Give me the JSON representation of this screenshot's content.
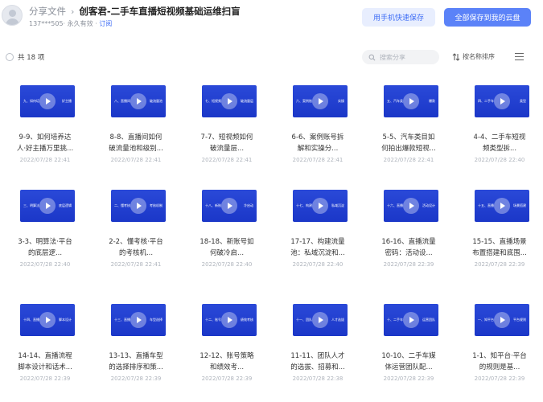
{
  "header": {
    "breadcrumb_root": "分享文件",
    "separator": "›",
    "title": "创客君-二手车直播短视频基础运维扫盲",
    "owner": "137***505",
    "validity": "· 永久有效 · ",
    "subscribe": "订阅",
    "save_phone_label": "用手机快速保存",
    "save_all_label": "全部保存到我的云盘"
  },
  "toolbar": {
    "total": "共 18 项",
    "search_placeholder": "搜索分享",
    "sort_label": "按名称排序"
  },
  "files": [
    {
      "line1": "9-9、如何培养达",
      "line2": "人·好主播万里挑...",
      "date": "2022/07/28 22:41",
      "cap_left": "九、如何培",
      "cap_right": "好主播"
    },
    {
      "line1": "8-8、直播间如何",
      "line2": "破流量池和级别...",
      "date": "2022/07/28 22:41",
      "cap_left": "八、直播间",
      "cap_right": "破流量池"
    },
    {
      "line1": "7-7、短视频如何",
      "line2": "破流量层...",
      "date": "2022/07/28 22:41",
      "cap_left": "七、短视频",
      "cap_right": "破流量层"
    },
    {
      "line1": "6-6、案例账号拆",
      "line2": "解和实操分...",
      "date": "2022/07/28 22:41",
      "cap_left": "六、案例账",
      "cap_right": "实操"
    },
    {
      "line1": "5-5、汽车类目如",
      "line2": "何拍出爆款短视...",
      "date": "2022/07/28 22:41",
      "cap_left": "五、汽车类",
      "cap_right": "爆款"
    },
    {
      "line1": "4-4、二手车短视",
      "line2": "频类型拆...",
      "date": "2022/07/28 22:40",
      "cap_left": "四、二手车",
      "cap_right": "类型"
    },
    {
      "line1": "3-3、明算法·平台",
      "line2": "的底层逻...",
      "date": "2022/07/28 22:40",
      "cap_left": "三、明算法",
      "cap_right": "底层逻辑"
    },
    {
      "line1": "2-2、懂考核·平台",
      "line2": "的考核机...",
      "date": "2022/07/28 22:41",
      "cap_left": "二、懂考核",
      "cap_right": "考核机制"
    },
    {
      "line1": "18-18、新账号如",
      "line2": "何破冷启...",
      "date": "2022/07/28 22:40",
      "cap_left": "十八、新账",
      "cap_right": "冷启动"
    },
    {
      "line1": "17-17、构建流量",
      "line2": "池：私域沉淀和...",
      "date": "2022/07/28 22:40",
      "cap_left": "十七、构建",
      "cap_right": "私域沉淀"
    },
    {
      "line1": "16-16、直播流量",
      "line2": "密码：活动设...",
      "date": "2022/07/28 22:39",
      "cap_left": "十六、直播",
      "cap_right": "活动设计"
    },
    {
      "line1": "15-15、直播场景",
      "line2": "布置搭建和底围...",
      "date": "2022/07/28 22:39",
      "cap_left": "十五、直播",
      "cap_right": "场景搭建"
    },
    {
      "line1": "14-14、直播流程",
      "line2": "脚本设计和话术...",
      "date": "2022/07/28 22:39",
      "cap_left": "十四、直播",
      "cap_right": "脚本设计"
    },
    {
      "line1": "13-13、直播车型",
      "line2": "的选择排序和策...",
      "date": "2022/07/28 22:39",
      "cap_left": "十三、直播",
      "cap_right": "车型选择"
    },
    {
      "line1": "12-12、账号策略",
      "line2": "和绩效考...",
      "date": "2022/07/28 22:39",
      "cap_left": "十二、账号",
      "cap_right": "绩效考核"
    },
    {
      "line1": "11-11、团队人才",
      "line2": "的选拔、招募和...",
      "date": "2022/07/28 22:38",
      "cap_left": "十一、团队",
      "cap_right": "人才选拔"
    },
    {
      "line1": "10-10、二手车媒",
      "line2": "体运营团队配...",
      "date": "2022/07/28 22:39",
      "cap_left": "十、二手车",
      "cap_right": "运营团队"
    },
    {
      "line1": "1-1、知平台·平台",
      "line2": "的规则是基...",
      "date": "2022/07/28 22:39",
      "cap_left": "一、知平台",
      "cap_right": "平台规则"
    }
  ]
}
